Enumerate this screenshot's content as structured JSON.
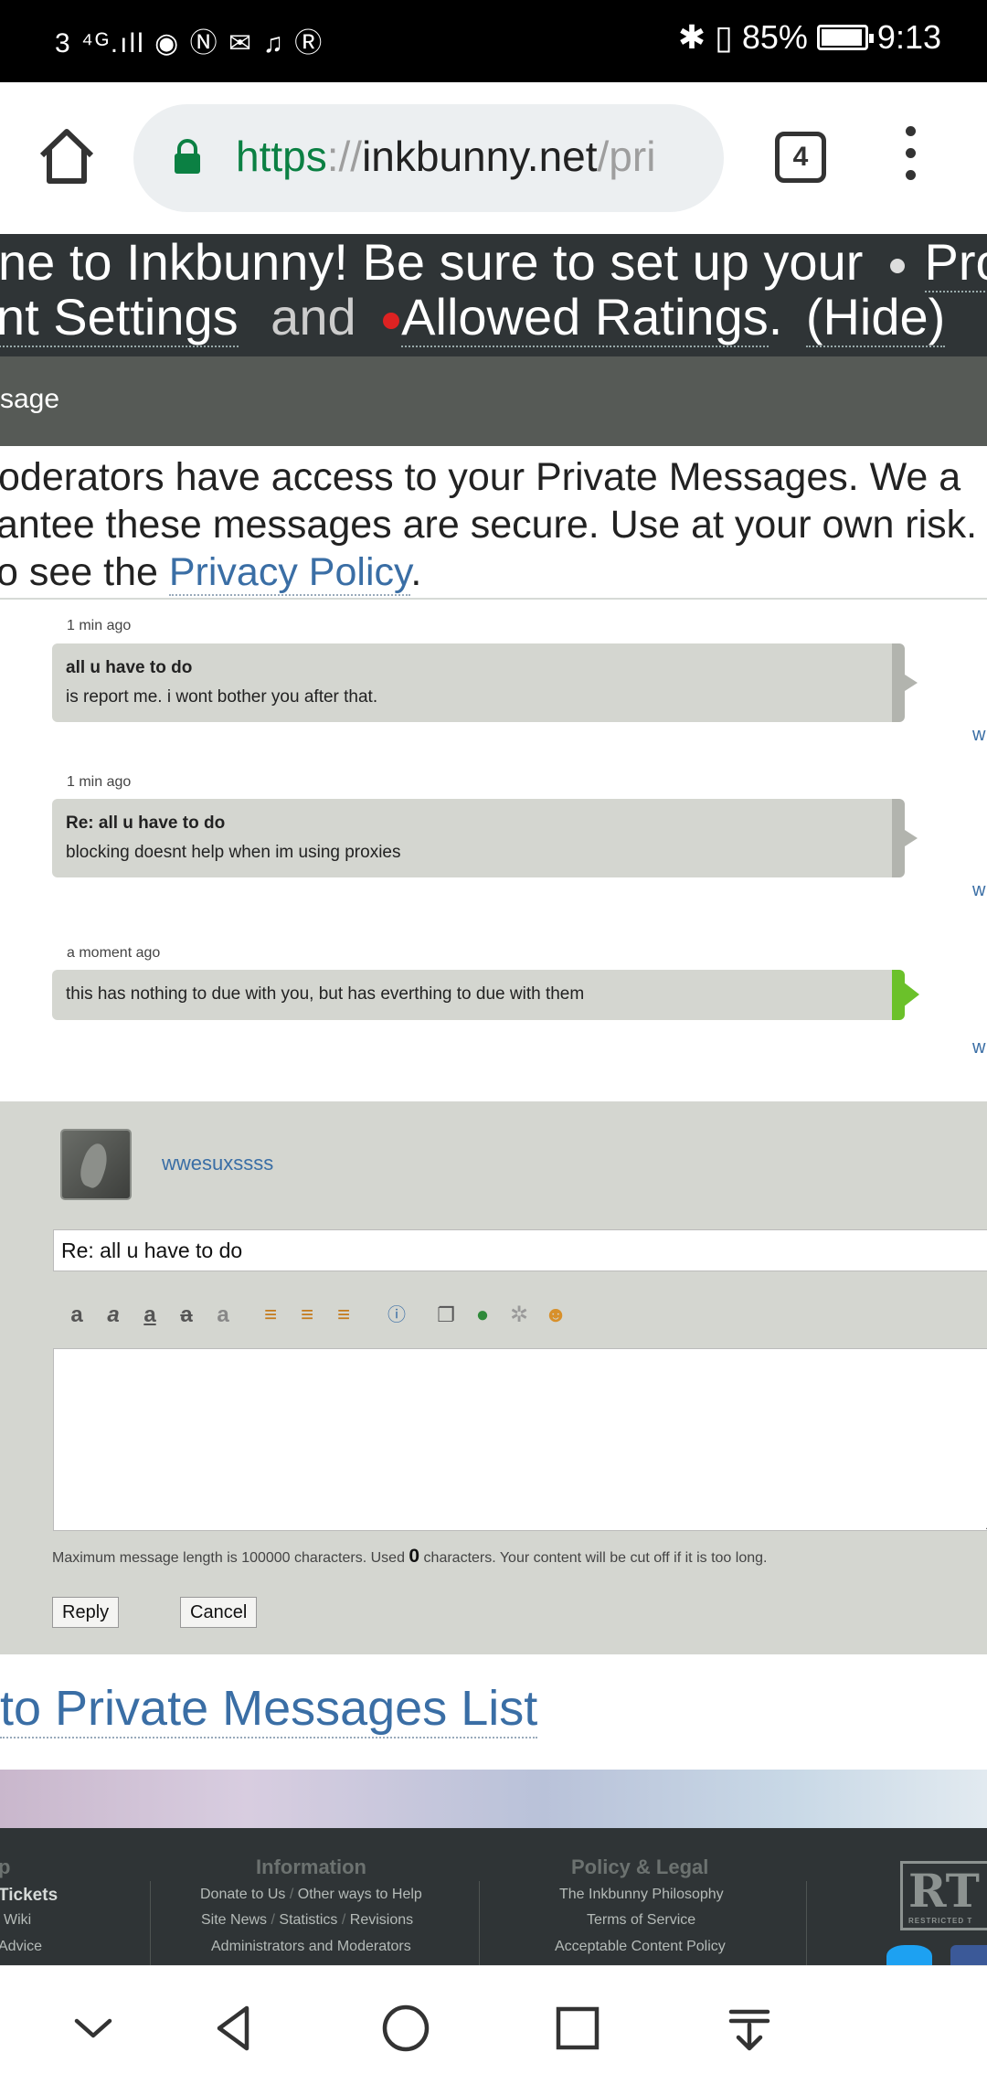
{
  "status_bar": {
    "left_text": "3 ⁴ᴳ.ıll ◉ Ⓝ ✉ ♫ Ⓡ",
    "battery": "85%",
    "time": "9:13"
  },
  "browser": {
    "url_scheme": "https",
    "url_sep": "://",
    "url_host": "inkbunny.net",
    "url_path": "/pri",
    "tab_count": "4"
  },
  "banner": {
    "line1_text": "ne to Inkbunny! Be sure to set up your",
    "line1_link": "Prof",
    "line2_link1": "nt Settings",
    "line2_and": "and",
    "line2_link2": "Allowed Ratings",
    "line2_dot": ".",
    "hide": "(Hide)"
  },
  "header": {
    "title": "sage"
  },
  "notice": {
    "line1": "oderators have access to your Private Messages. We a",
    "line2": "antee these messages are secure. Use at your own risk.",
    "line3_prefix": "o see the ",
    "line3_link": "Privacy Policy",
    "line3_suffix": "."
  },
  "messages": [
    {
      "time": "1 min ago",
      "subject": "all u have to do",
      "body": "is report me. i wont bother you after that.",
      "mine": false,
      "side_label": "w"
    },
    {
      "time": "1 min ago",
      "subject": "Re: all u have to do",
      "body": "blocking doesnt help when im using proxies",
      "mine": false,
      "side_label": "w"
    },
    {
      "time": "a moment ago",
      "subject": "",
      "body": "this has nothing to due with you, but has everthing to due with them",
      "mine": true,
      "side_label": "w"
    }
  ],
  "reply": {
    "username": "wwesuxssss",
    "subject_value": "Re: all u have to do",
    "message_value": "",
    "max_prefix": "Maximum message length is 100000 characters. Used ",
    "max_count": "0",
    "max_suffix": " characters. Your content will be cut off if it is too long.",
    "reply_label": "Reply",
    "cancel_label": "Cancel"
  },
  "back_link": "to Private Messages List",
  "footer": {
    "col0_head": "p",
    "col0_items": [
      "Tickets",
      "Wiki",
      "Advice"
    ],
    "col1_head": "Information",
    "col1_row1": [
      "Donate to Us",
      "Other ways to Help"
    ],
    "col1_row2": [
      "Site News",
      "Statistics",
      "Revisions"
    ],
    "col1_row3": "Administrators and Moderators",
    "col2_head": "Policy & Legal",
    "col2_items": [
      "The Inkbunny Philosophy",
      "Terms of Service",
      "Acceptable Content Policy"
    ],
    "sep": "/",
    "rta_big": "RT",
    "rta_small": "RESTRICTED T"
  },
  "colors": {
    "link": "#3a6ea5",
    "mine_accent": "#6bc12a",
    "secure_green": "#0b8043",
    "banner_bg": "#2f3436"
  }
}
